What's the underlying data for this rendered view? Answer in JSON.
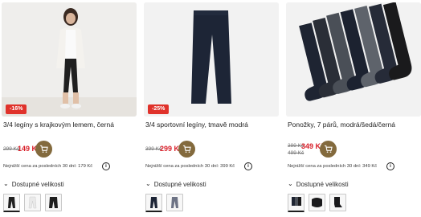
{
  "colors": {
    "sale": "#d81e28",
    "badge": "#e0322b",
    "cart": "#836a3d"
  },
  "products": [
    {
      "badge": "-16%",
      "title": "3/4 legíny s krajkovým lemem, černá",
      "old_price": "299 Kč",
      "price": "149 Kč",
      "lowest_price": "Nejnižší cena za posledních 30 dní: 179 Kč",
      "sizes_label": "Dostupné velikosti",
      "variants": [
        "černá",
        "bílá",
        "černá"
      ]
    },
    {
      "badge": "-25%",
      "title": "3/4 sportovní legíny, tmavě modrá",
      "old_price": "399 Kč",
      "price": "299 Kč",
      "lowest_price": "Nejnižší cena za posledních 30 dní: 399 Kč",
      "sizes_label": "Dostupné velikosti",
      "variants": [
        "tmavě modrá",
        "šedá"
      ]
    },
    {
      "badge": "",
      "title": "Ponožky, 7 párů, modrá/šedá/černá",
      "old_price": "399 Kč",
      "price": "349 Kč",
      "old_price_2": "499 Kč",
      "lowest_price": "Nejnižší cena za posledních 30 dní: 349 Kč",
      "sizes_label": "Dostupné velikosti",
      "variants": [
        "modrá/šedá/černá",
        "černá",
        "černá"
      ]
    }
  ]
}
